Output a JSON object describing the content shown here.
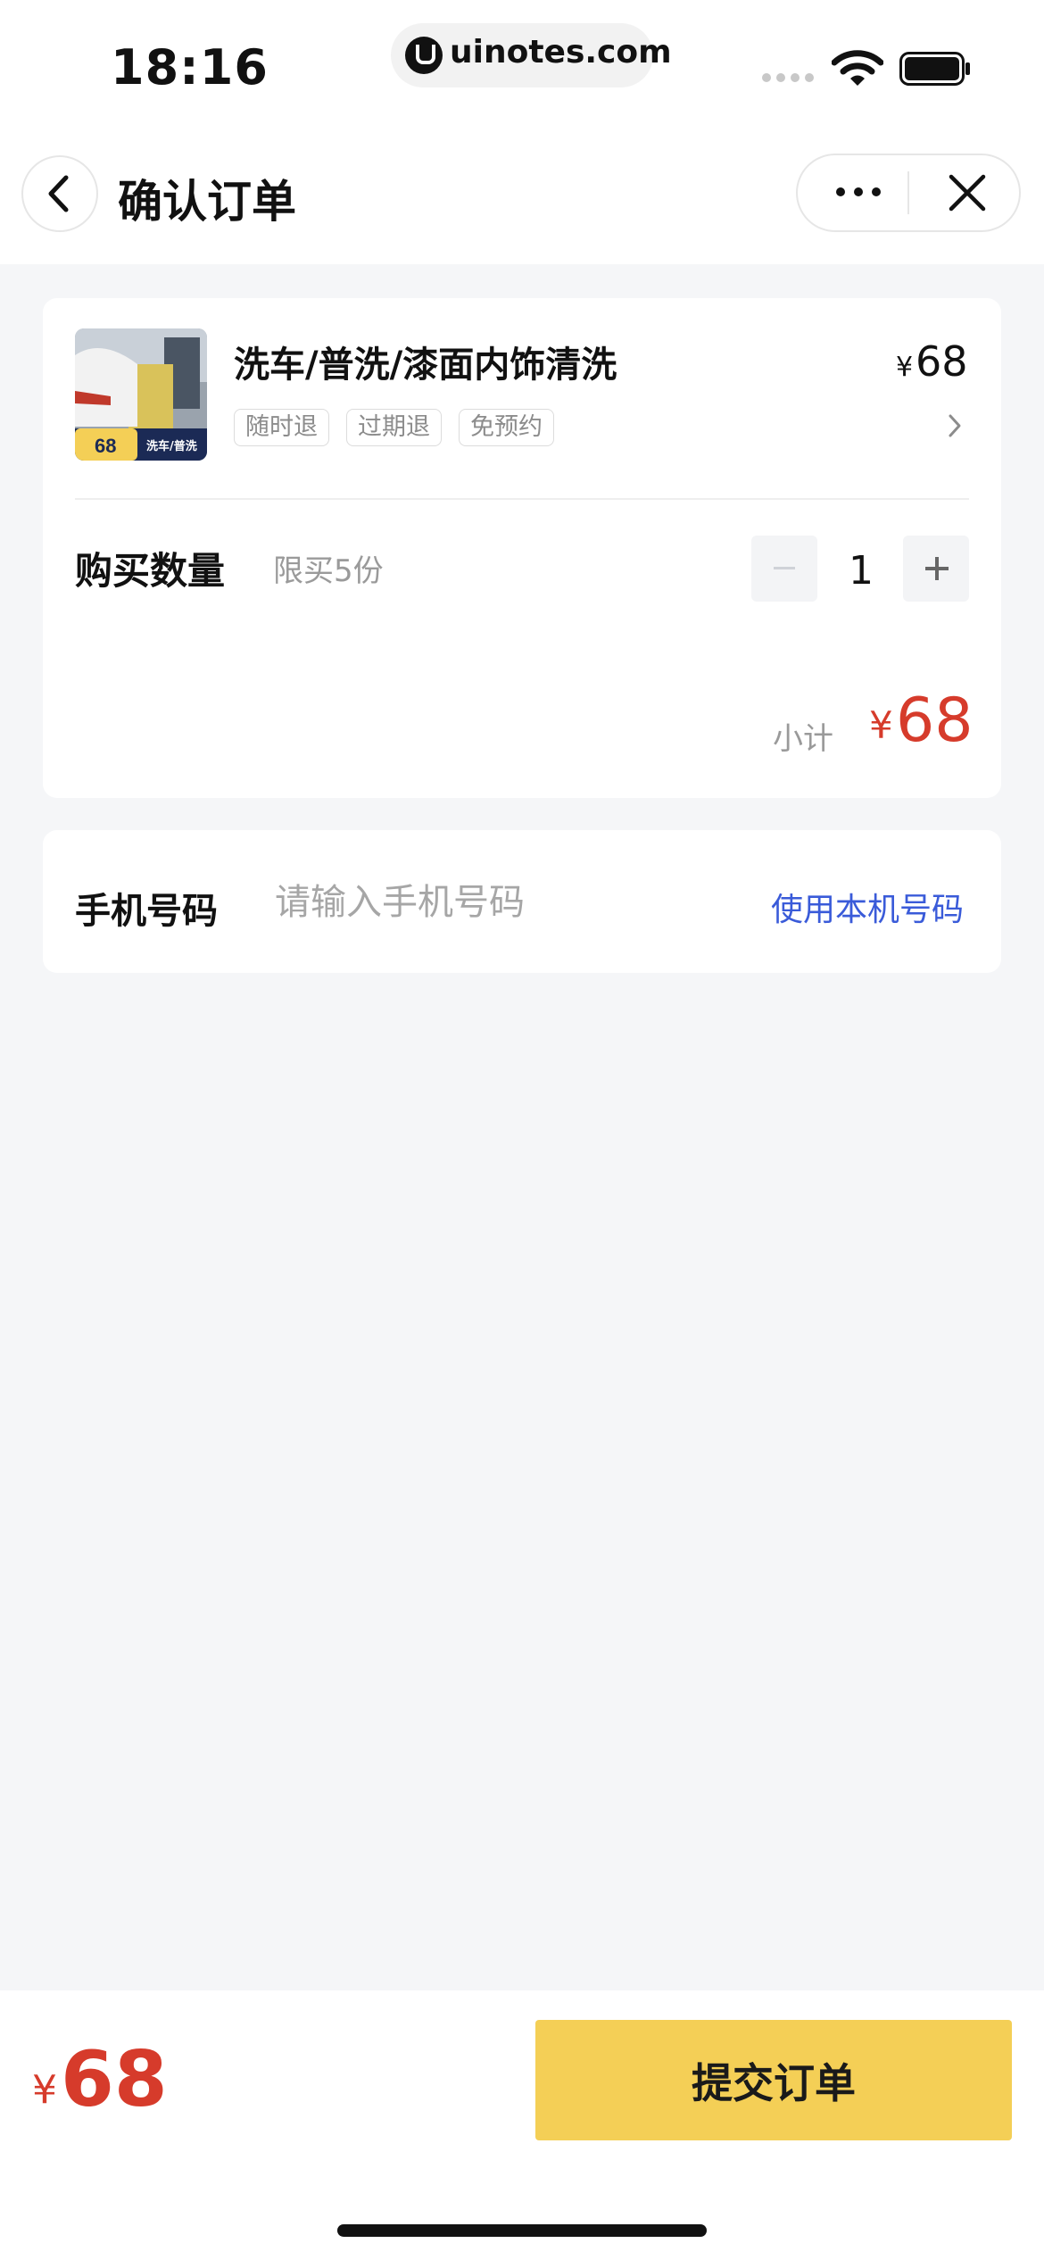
{
  "status_bar": {
    "time": "18:16",
    "site": "uinotes.com"
  },
  "nav": {
    "title": "确认订单"
  },
  "product": {
    "name": "洗车/普洗/漆面内饰清洗",
    "price_symbol": "¥",
    "price": "68",
    "tags": [
      "随时退",
      "过期退",
      "免预约"
    ],
    "thumb_badge_price": "68",
    "thumb_badge_text": "洗车/普洗"
  },
  "quantity": {
    "label": "购买数量",
    "limit": "限买5份",
    "value": "1"
  },
  "subtotal": {
    "label": "小计",
    "symbol": "¥",
    "amount": "68"
  },
  "phone": {
    "label": "手机号码",
    "placeholder": "请输入手机号码",
    "value": "",
    "use_local": "使用本机号码"
  },
  "footer": {
    "symbol": "¥",
    "total": "68",
    "submit_label": "提交订单"
  },
  "colors": {
    "accent_red": "#d63b2b",
    "submit_yellow": "#f4cf56",
    "link_blue": "#3a5bd9",
    "page_bg": "#f5f6f8"
  },
  "icons": {
    "back": "chevron-left-icon",
    "more": "more-dots-icon",
    "close": "close-icon",
    "detail": "chevron-right-icon",
    "wifi": "wifi-icon",
    "battery": "battery-icon",
    "signal": "signal-icon"
  }
}
